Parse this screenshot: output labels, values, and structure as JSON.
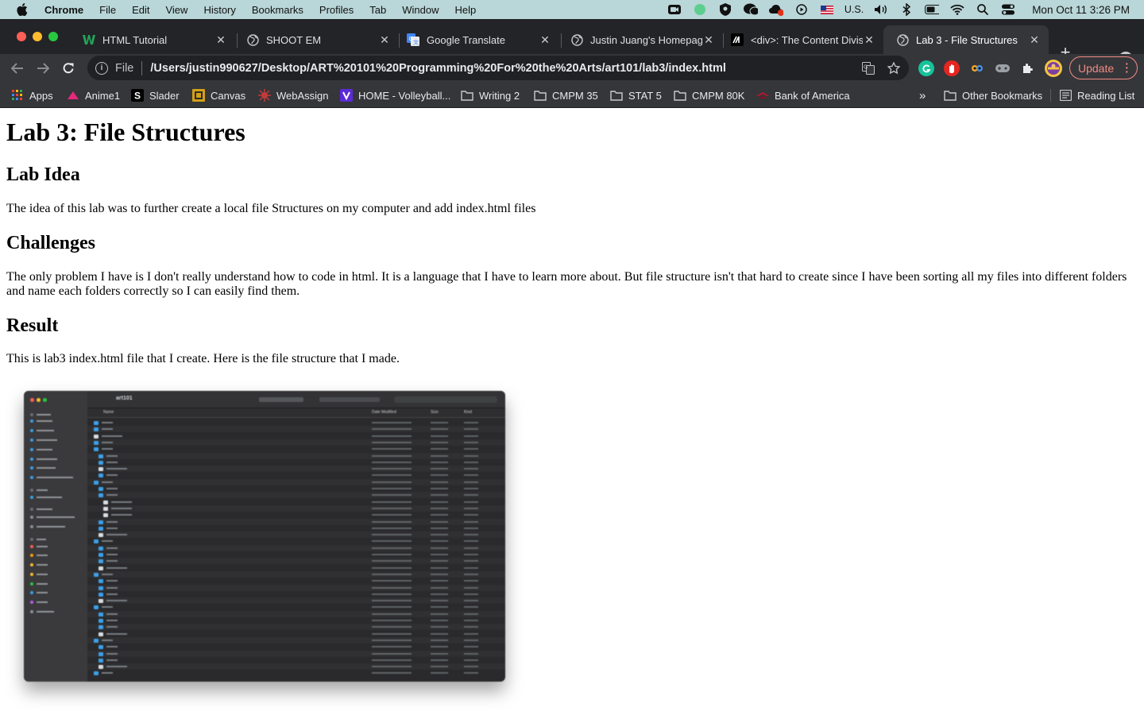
{
  "menubar": {
    "app_name": "Chrome",
    "items": [
      "File",
      "Edit",
      "View",
      "History",
      "Bookmarks",
      "Profiles",
      "Tab",
      "Window",
      "Help"
    ],
    "input_source": "U.S.",
    "clock": "Mon Oct 11  3:26 PM"
  },
  "tabs": [
    {
      "title": "HTML Tutorial",
      "icon": "w3schools-icon"
    },
    {
      "title": "SHOOT EM",
      "icon": "globe-icon"
    },
    {
      "title": "Google Translate",
      "icon": "google-translate-icon"
    },
    {
      "title": "Justin Juang's Homepage",
      "icon": "globe-icon"
    },
    {
      "title": "<div>: The Content Division",
      "icon": "mdn-icon"
    },
    {
      "title": "Lab 3 - File Structures",
      "icon": "globe-icon",
      "active": true
    }
  ],
  "toolbar": {
    "file_label": "File",
    "url": "/Users/justin990627/Desktop/ART%20101%20Programming%20For%20the%20Arts/art101/lab3/index.html",
    "update_label": "Update"
  },
  "bookmarks": {
    "items": [
      "Apps",
      "Anime1",
      "Slader",
      "Canvas",
      "WebAssign",
      "HOME - Volleyball...",
      "Writing 2",
      "CMPM 35",
      "STAT 5",
      "CMPM 80K",
      "Bank of America"
    ],
    "overflow": "»",
    "other": "Other Bookmarks",
    "reading_list": "Reading List"
  },
  "page": {
    "title": "Lab 3: File Structures",
    "sections": [
      {
        "heading": "Lab Idea",
        "text": "The idea of this lab was to further create a local file Structures on my computer and add index.html files"
      },
      {
        "heading": "Challenges",
        "text": "The only problem I have is I don't really understand how to code in html. It is a language that I have to learn more about. But file structure isn't that hard to create since I have been sorting all my files into different folders and name each folders correctly so I can easily find them."
      },
      {
        "heading": "Result",
        "text": "This is lab3 index.html file that I create. Here is the file structure that I made."
      }
    ],
    "screenshot": {
      "window_title": "art101",
      "column_name": "Name",
      "column_date": "Date Modified",
      "column_size": "Size",
      "column_kind": "Kind"
    }
  },
  "colors": {
    "menubar": "#b9d6d8",
    "tabstrip": "#232427",
    "active_tab": "#35363a",
    "omnibox": "#202124",
    "update_accent": "#f28b82",
    "folder_blue": "#3ba0ea"
  }
}
